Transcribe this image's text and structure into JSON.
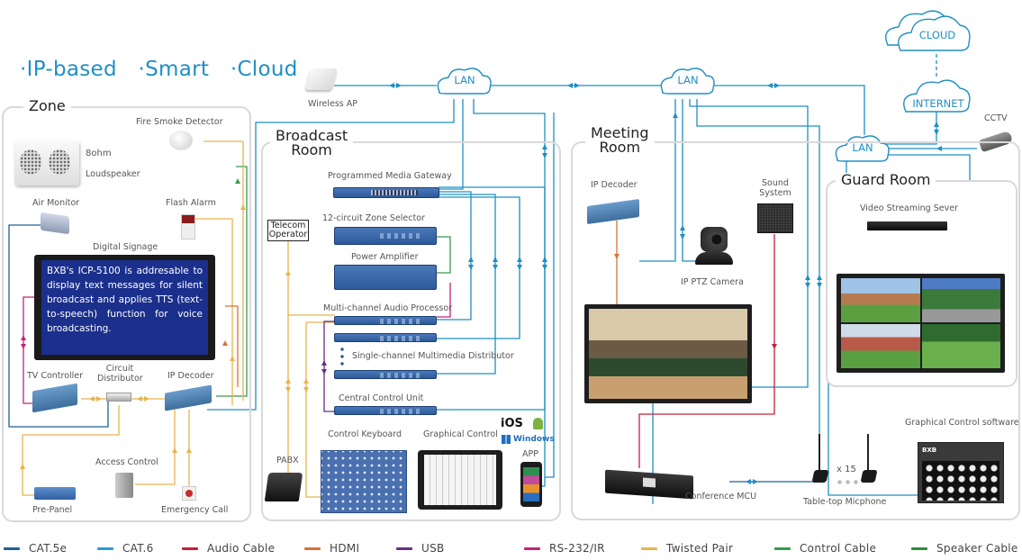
{
  "tagline": [
    "·IP-based",
    "·Smart",
    "·Cloud"
  ],
  "network": {
    "lan_left": "LAN",
    "lan_center": "LAN",
    "lan_right": "LAN",
    "cloud": "CLOUD",
    "internet": "INTERNET",
    "wireless_ap": "Wireless AP",
    "cctv": "CCTV"
  },
  "rooms": {
    "zone": {
      "title": "Zone",
      "devices": {
        "fire_smoke_detector": "Fire Smoke Detector",
        "speaker_impedance": "8ohm",
        "loudspeaker": "Loudspeaker",
        "air_monitor": "Air Monitor",
        "flash_alarm": "Flash Alarm",
        "digital_signage": "Digital Signage",
        "signage_text": "BXB's ICP-5100 is addresable to display text messages for silent broadcast and applies TTS (text-to-speech) function for voice broadcasting.",
        "tv_controller": "TV Controller",
        "circuit_distributor": "Circuit Distributor",
        "ip_decoder": "IP Decoder",
        "access_control": "Access Control",
        "pre_panel": "Pre-Panel",
        "emergency_call": "Emergency Call"
      }
    },
    "broadcast": {
      "title_line1": "Broadcast",
      "title_line2": "Room",
      "devices": {
        "media_gateway": "Programmed Media Gateway",
        "zone_selector": "12-circuit Zone Selector",
        "telecom_operator_line1": "Telecom",
        "telecom_operator_line2": "Operator",
        "power_amplifier": "Power Amplifier",
        "audio_processor": "Multi-channel Audio Processor",
        "multimedia_distributor": "Single-channel Multimedia Distributor",
        "central_control_unit": "Central Control Unit",
        "control_keyboard": "Control Keyboard",
        "graphical_control": "Graphical Control",
        "pabx": "PABX",
        "app": "APP",
        "os_ios": "iOS",
        "os_windows": "Windows"
      }
    },
    "meeting": {
      "title_line1": "Meeting",
      "title_line2": "Room",
      "devices": {
        "ip_decoder": "IP Decoder",
        "ptz_camera": "IP PTZ Camera",
        "sound_system_line1": "Sound",
        "sound_system_line2": "System",
        "conference_mcu": "Conference MCU",
        "mic_count": "x 15",
        "tabletop_mic": "Table-top  Micphone",
        "graphical_control_software": "Graphical Control software"
      }
    },
    "guard": {
      "title": "Guard Room",
      "devices": {
        "video_streaming_server": "Video Streaming Sever"
      }
    }
  },
  "legend": [
    {
      "label": "CAT.5e",
      "color": "#1f5f95"
    },
    {
      "label": "CAT.6",
      "color": "#2a9ad6"
    },
    {
      "label": "Audio Cable",
      "color": "#c4203a"
    },
    {
      "label": "HDMI",
      "color": "#d9703a"
    },
    {
      "label": "USB",
      "color": "#6a2d86"
    },
    {
      "label": "RS-232/IR",
      "color": "#c2247a"
    },
    {
      "label": "Twisted Pair",
      "color": "#e8b44e"
    },
    {
      "label": "Control Cable",
      "color": "#3a9a4a"
    },
    {
      "label": "Speaker Cable",
      "color": "#2e8b3e"
    }
  ]
}
